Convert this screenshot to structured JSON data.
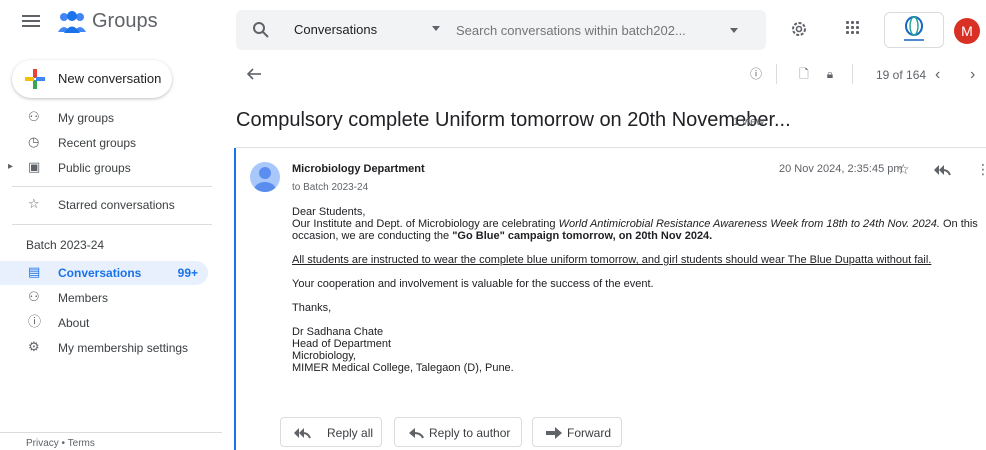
{
  "app": {
    "title": "Groups"
  },
  "sidebar": {
    "new_conversation": "New conversation",
    "items": [
      {
        "label": "My groups",
        "icon": "groups-icon"
      },
      {
        "label": "Recent groups",
        "icon": "clock-icon"
      },
      {
        "label": "Public groups",
        "icon": "folder-icon"
      },
      {
        "label": "Starred conversations",
        "icon": "star-icon"
      }
    ],
    "batch_title": "Batch 2023-24",
    "batch_items": [
      {
        "label": "Conversations",
        "icon": "conversations-icon",
        "badge": "99+"
      },
      {
        "label": "Members",
        "icon": "members-icon"
      },
      {
        "label": "About",
        "icon": "info-icon"
      },
      {
        "label": "My membership settings",
        "icon": "membership-settings-icon"
      }
    ],
    "footer": "Privacy • Terms"
  },
  "search": {
    "scope": "Conversations",
    "placeholder": "Search conversations within batch202..."
  },
  "toolbar": {
    "pager": "19 of 164"
  },
  "conversation": {
    "subject": "Compulsory complete Uniform tomorrow on 20th Novemeber...",
    "views": "1 view",
    "sender": "Microbiology Department",
    "recipient": "to Batch 2023-24",
    "date": "20 Nov 2024, 2:35:45 pm",
    "greeting": "Dear Students,",
    "line1_a": "Our Institute and Dept. of Microbiology are celebrating ",
    "line1_italic": "World Antimicrobial Resistance Awareness Week from 18th to 24th Nov. 2024.",
    "line1_b": " On this",
    "line2_a": "occasion, we are conducting the ",
    "line2_bold": "\"Go Blue\" campaign tomorrow, on 20th Nov 2024.",
    "instruction": "All students are instructed to wear the complete blue uniform tomorrow, and girl students should wear The Blue Dupatta without fail.",
    "cooperation": "Your cooperation and involvement is valuable for the success of the event.",
    "thanks": "Thanks,",
    "signature": [
      "Dr Sadhana Chate",
      "Head of Department",
      "Microbiology,",
      "MIMER Medical College, Talegaon (D), Pune."
    ]
  },
  "actions": {
    "reply_all": "Reply all",
    "reply_to_author": "Reply to author",
    "forward": "Forward"
  },
  "avatar_letter": "M",
  "colors": {
    "accent": "#1a73e8",
    "avatar": "#d93025",
    "active_bg": "#e8f0fe"
  }
}
